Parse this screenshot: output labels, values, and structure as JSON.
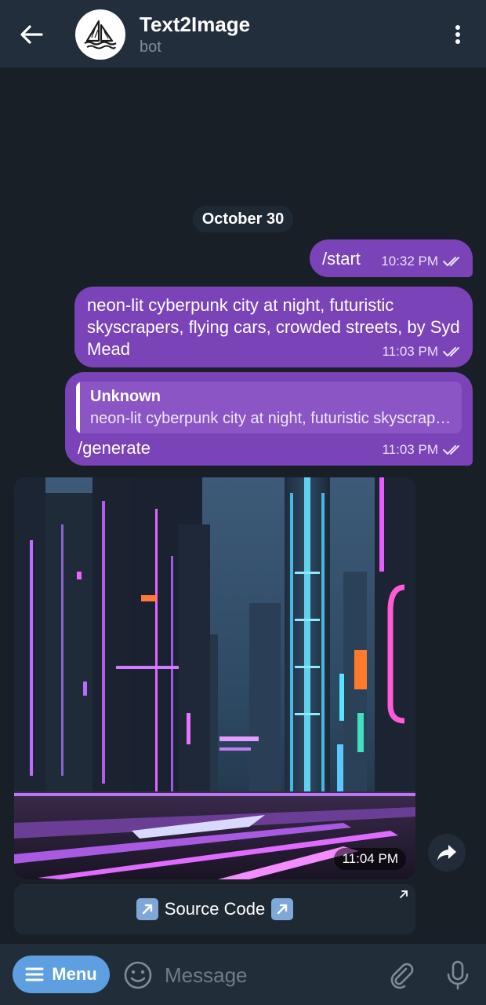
{
  "header": {
    "title": "Text2Image",
    "subtitle": "bot"
  },
  "chat": {
    "date_label": "October 30",
    "messages": [
      {
        "text": "/start",
        "time": "10:32 PM"
      },
      {
        "text": "neon-lit cyberpunk city at night, futuristic skyscrapers, flying cars, crowded streets, by Syd Mead",
        "time": "11:03 PM"
      },
      {
        "reply_name": "Unknown",
        "reply_snippet": "neon-lit cyberpunk city at night, futuristic skyscrapers, flying cars, crowded streets, by Syd Mead",
        "text": "/generate",
        "time": "11:03 PM"
      }
    ],
    "image_message": {
      "time": "11:04 PM"
    },
    "inline_button": {
      "label": "Source Code"
    }
  },
  "input_bar": {
    "menu_label": "Menu",
    "message_placeholder": "Message"
  },
  "colors": {
    "header_bg": "#232e3c",
    "chat_bg": "#181f27",
    "outgoing_bubble": "#7a43b8",
    "menu_button": "#5d9fe0"
  }
}
